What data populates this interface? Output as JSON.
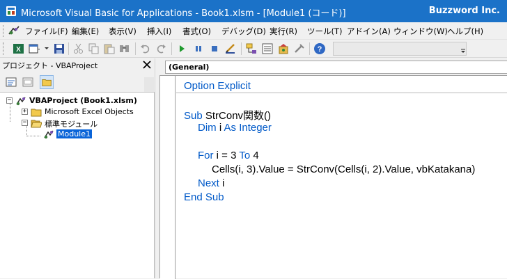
{
  "window": {
    "title": "Microsoft Visual Basic for Applications - Book1.xlsm - [Module1 (コード)]",
    "brand": "Buzzword Inc."
  },
  "menu": [
    {
      "label": "ファイル(F)"
    },
    {
      "label": "編集(E)"
    },
    {
      "label": "表示(V)"
    },
    {
      "label": "挿入(I)"
    },
    {
      "label": "書式(O)"
    },
    {
      "label": "デバッグ(D)"
    },
    {
      "label": "実行(R)"
    },
    {
      "label": "ツール(T)"
    },
    {
      "label": "アドイン(A)"
    },
    {
      "label": "ウィンドウ(W)"
    },
    {
      "label": "ヘルプ(H)"
    }
  ],
  "toolbar": {
    "icons": [
      "excel-view-icon",
      "insert-module-icon",
      "save-icon",
      "cut-icon",
      "copy-icon",
      "paste-icon",
      "find-icon",
      "undo-icon",
      "redo-icon",
      "run-icon",
      "break-icon",
      "reset-icon",
      "design-mode-icon",
      "project-explorer-icon",
      "properties-icon",
      "object-browser-icon",
      "toolbox-icon",
      "help-icon"
    ]
  },
  "project_panel": {
    "title": "プロジェクト - VBAProject",
    "tree": {
      "root": "VBAProject (Book1.xlsm)",
      "excel_objects": "Microsoft Excel Objects",
      "modules_folder": "標準モジュール",
      "module": "Module1"
    }
  },
  "code_window": {
    "object_combo": "(General)",
    "lines": {
      "l1_kw": "Option Explicit",
      "l2_kw": "Sub",
      "l2_rest": " StrConv関数()",
      "l3_kw1": "Dim",
      "l3_mid": " i ",
      "l3_kw2": "As Integer",
      "l4_kw1": "For",
      "l4_mid": " i = 3 ",
      "l4_kw2": "To",
      "l4_end": " 4",
      "l5": "Cells(i, 3).Value = StrConv(Cells(i, 2).Value, vbKatakana)",
      "l6_kw": "Next",
      "l6_rest": " i",
      "l7_kw": "End Sub"
    }
  },
  "colors": {
    "titlebar": "#1b72c8",
    "keyword": "#0059c8",
    "selection": "#0a64d8"
  }
}
